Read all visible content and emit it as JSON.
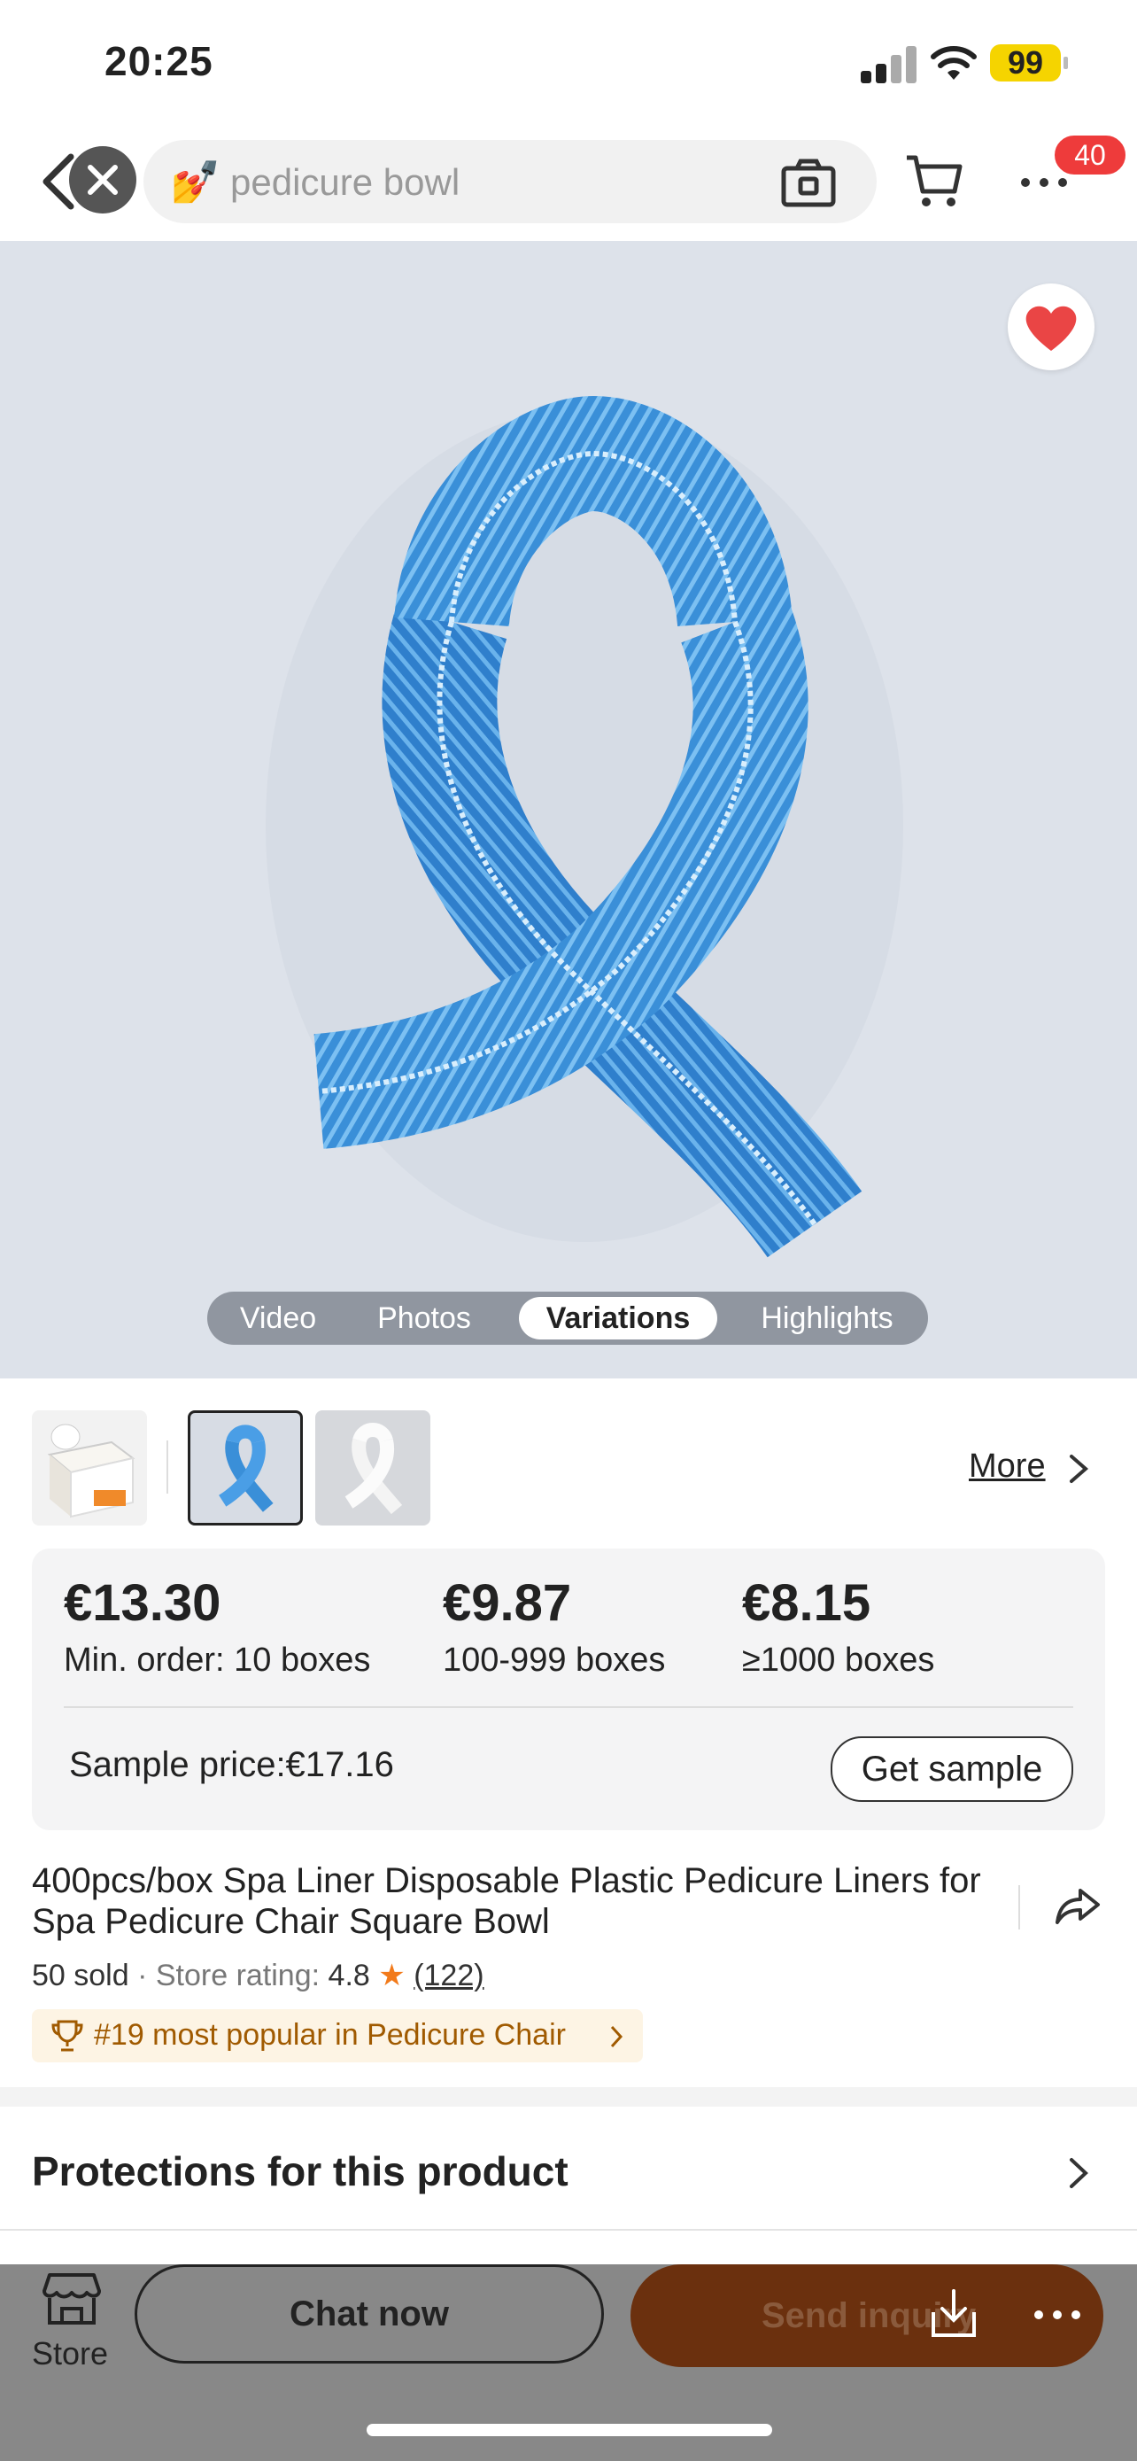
{
  "status_bar": {
    "time": "20:25",
    "battery": "99"
  },
  "nav": {
    "search_emoji": "💅",
    "search_query": "pedicure bowl",
    "cart_badge": "40",
    "icons": [
      "back-icon",
      "close-icon",
      "camera-icon",
      "cart-icon",
      "more-icon"
    ]
  },
  "gallery": {
    "tabs": [
      "Video",
      "Photos",
      "Variations",
      "Highlights"
    ],
    "active_tab": "Variations",
    "thumbnails": [
      "box-thumbnail",
      "blue-liner-thumbnail",
      "white-liner-thumbnail"
    ],
    "selected_thumbnail": 1,
    "more_label": "More"
  },
  "pricing": {
    "tiers": [
      {
        "price": "€13.30",
        "qty": "Min. order: 10 boxes"
      },
      {
        "price": "€9.87",
        "qty": "100-999 boxes"
      },
      {
        "price": "€8.15",
        "qty": "≥1000 boxes"
      }
    ],
    "sample_label": "Sample price:€17.16",
    "sample_button": "Get sample"
  },
  "product": {
    "title": "400pcs/box Spa Liner Disposable Plastic Pedicure Liners for Spa Pedicure Chair Square Bowl",
    "sold": "50 sold",
    "separator": " · ",
    "rating_label": "Store rating:",
    "rating": "4.8",
    "rating_count": "(122)",
    "rank": "#19 most popular in Pedicure Chair"
  },
  "protections": {
    "title": "Protections for this product"
  },
  "bottom_bar": {
    "store_label": "Store",
    "chat_label": "Chat now",
    "inquiry_label": "Send inquiry"
  },
  "colors": {
    "accent": "#ee3b3b",
    "heart": "#ea4545",
    "inquiry": "#6b300e",
    "liner": "#3a8fd8"
  }
}
